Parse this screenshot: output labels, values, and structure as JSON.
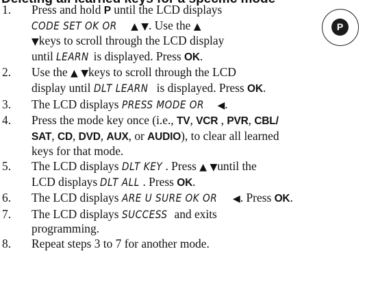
{
  "heading_partial": "Deleting all learned keys for a specific mode",
  "p_badge": "P",
  "steps": [
    {
      "num": "1.",
      "l1": [
        "Press and hold ",
        "P",
        " until the LCD displays"
      ],
      "l2": [
        "CODE SET OK OR",
        "▲ ▼",
        ". Use the ",
        "▲"
      ],
      "l3": [
        "▼",
        "keys to scroll through the LCD display"
      ],
      "l4": [
        "until ",
        "LEARN",
        " is displayed. Press ",
        "OK",
        "."
      ]
    },
    {
      "num": "2.",
      "l1": [
        "Use the ",
        "▲ ▼",
        "keys to scroll through the LCD"
      ],
      "l2": [
        "display until ",
        "DLT LEARN",
        " is displayed. Press ",
        "OK",
        "."
      ]
    },
    {
      "num": "3.",
      "l1": [
        "The LCD displays ",
        "PRESS MODE OR",
        " ◀",
        "."
      ]
    },
    {
      "num": "4.",
      "l1": [
        "Press the mode key once (i.e., ",
        "TV",
        ", ",
        "VCR",
        " , ",
        "PVR",
        ", ",
        "CBL/"
      ],
      "l2": [
        "SAT",
        ", ",
        "CD",
        ", ",
        "DVD",
        ", ",
        "AUX",
        ", or ",
        "AUDIO",
        "), to clear all learned"
      ],
      "l3": [
        "keys for that mode."
      ]
    },
    {
      "num": "5.",
      "l1": [
        "The LCD displays ",
        "DLT KEY",
        ". Press ",
        "▲ ▼",
        "until the"
      ],
      "l2": [
        "LCD displays ",
        "DLT ALL",
        ". Press ",
        "OK",
        "."
      ]
    },
    {
      "num": "6.",
      "l1": [
        "The LCD displays ",
        "ARE U SURE OK OR",
        " ◀",
        ". Press ",
        "OK",
        "."
      ]
    },
    {
      "num": "7.",
      "l1": [
        "The LCD displays ",
        "SUCCESS",
        " and exits"
      ],
      "l2": [
        "programming."
      ]
    },
    {
      "num": "8.",
      "l1": [
        "Repeat steps 3 to 7 for another mode."
      ]
    }
  ]
}
